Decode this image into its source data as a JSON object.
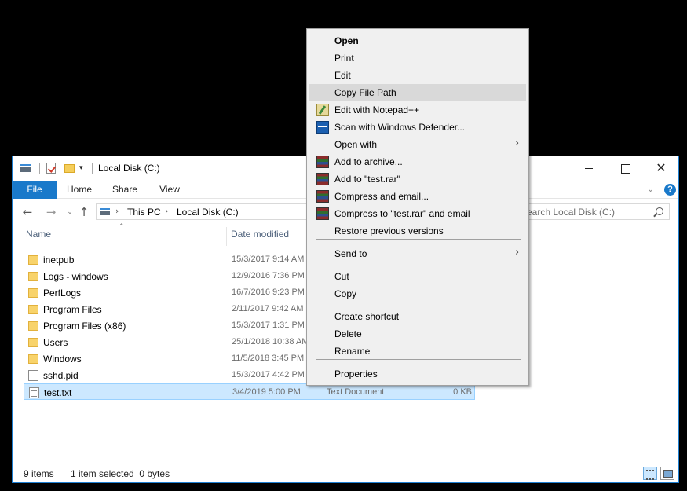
{
  "window": {
    "title": "Local Disk (C:)",
    "controls": {
      "minimize": "",
      "maximize": "",
      "close": "✕"
    }
  },
  "qat": {
    "dropdown": "▾"
  },
  "ribbon": {
    "tabs": [
      {
        "label": "File"
      },
      {
        "label": "Home"
      },
      {
        "label": "Share"
      },
      {
        "label": "View"
      }
    ],
    "collapse": "⌄",
    "help": "?",
    "accent": "#1979ca"
  },
  "address": {
    "back": "←",
    "forward": "→",
    "recent": "⌄",
    "up": "↑",
    "separator": "›",
    "crumbs": [
      "This PC",
      "Local Disk (C:)"
    ],
    "search_placeholder": "Search Local Disk (C:)"
  },
  "columns": {
    "name": "Name",
    "date_modified": "Date modified",
    "sort_indicator": "⌃"
  },
  "files": [
    {
      "name": "inetpub",
      "date": "15/3/2017 9:14 AM",
      "type": "",
      "size": "",
      "kind": "folder"
    },
    {
      "name": "Logs - windows",
      "date": "12/9/2016 7:36 PM",
      "type": "",
      "size": "",
      "kind": "folder"
    },
    {
      "name": "PerfLogs",
      "date": "16/7/2016 9:23 PM",
      "type": "",
      "size": "",
      "kind": "folder"
    },
    {
      "name": "Program Files",
      "date": "2/11/2017 9:42 AM",
      "type": "",
      "size": "",
      "kind": "folder"
    },
    {
      "name": "Program Files (x86)",
      "date": "15/3/2017 1:31 PM",
      "type": "",
      "size": "",
      "kind": "folder"
    },
    {
      "name": "Users",
      "date": "25/1/2018 10:38 AM",
      "type": "",
      "size": "",
      "kind": "folder"
    },
    {
      "name": "Windows",
      "date": "11/5/2018 3:45 PM",
      "type": "",
      "size": "",
      "kind": "folder"
    },
    {
      "name": "sshd.pid",
      "date": "15/3/2017 4:42 PM",
      "type": "",
      "size": "",
      "kind": "file"
    },
    {
      "name": "test.txt",
      "date": "3/4/2019 5:00 PM",
      "type": "Text Document",
      "size": "0 KB",
      "kind": "text-file",
      "selected": true
    }
  ],
  "status": {
    "item_count": "9 items",
    "selection": "1 item selected  0 bytes"
  },
  "context_menu": {
    "highlight_color": "#d9d9d9",
    "items": [
      {
        "label": "Open",
        "bold": true
      },
      {
        "label": "Print"
      },
      {
        "label": "Edit"
      },
      {
        "label": "Copy File Path",
        "highlighted": true
      },
      {
        "label": "Edit with Notepad++",
        "icon": "notepad-plus-plus-icon"
      },
      {
        "label": "Scan with Windows Defender...",
        "icon": "windows-defender-icon"
      },
      {
        "label": "Open with",
        "submenu": true
      },
      {
        "label": "Add to archive...",
        "icon": "winrar-icon"
      },
      {
        "label": "Add to \"test.rar\"",
        "icon": "winrar-icon"
      },
      {
        "label": "Compress and email...",
        "icon": "winrar-icon"
      },
      {
        "label": "Compress to \"test.rar\" and email",
        "icon": "winrar-icon"
      },
      {
        "label": "Restore previous versions"
      },
      {
        "label": "Send to",
        "submenu": true
      },
      {
        "label": "Cut"
      },
      {
        "label": "Copy"
      },
      {
        "label": "Create shortcut"
      },
      {
        "label": "Delete"
      },
      {
        "label": "Rename"
      },
      {
        "label": "Properties"
      }
    ],
    "submenu_arrow": "›"
  }
}
